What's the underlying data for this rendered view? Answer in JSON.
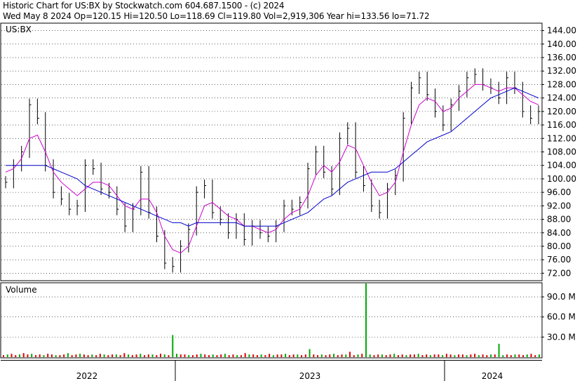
{
  "header": {
    "line1": "Historic Chart for US:BX by Stockwatch.com 604.687.1500 - (c) 2024",
    "line2": "Wed May  8 2024   Op=120.15   Hi=120.50   Lo=118.69   Cl=119.80   Vol=2,919,306   Year hi=133.56   lo=71.72"
  },
  "colors": {
    "price_bars": "#000000",
    "ma_short": "#cc00cc",
    "ma_long": "#0000cc",
    "volume_up": "#00aa00",
    "volume_down": "#dd0000",
    "grid": "#000000"
  },
  "chart_data": [
    {
      "type": "line",
      "subtype": "ohlc_bars_with_moving_averages",
      "title": "US:BX",
      "ylim": [
        70,
        146
      ],
      "y_ticks": [
        "144.00",
        "140.00",
        "136.00",
        "132.00",
        "128.00",
        "124.00",
        "120.00",
        "116.00",
        "112.00",
        "108.00",
        "104.00",
        "100.00",
        "96.00",
        "92.00",
        "88.00",
        "84.00",
        "80.00",
        "76.00",
        "72.00"
      ],
      "x_ticks": [
        "2022",
        "2023",
        "2024"
      ],
      "series": [
        {
          "name": "",
          "values": [
            99,
            104,
            108,
            122,
            118,
            104,
            96,
            94,
            91,
            92,
            104,
            103,
            97,
            96,
            91,
            86,
            91,
            102,
            90,
            83,
            75,
            74,
            80,
            85,
            96,
            98,
            90,
            88,
            84,
            88,
            82,
            86,
            84,
            83,
            86,
            92,
            91,
            93,
            103,
            108,
            102,
            97,
            112,
            115,
            102,
            98,
            92,
            90,
            97,
            101,
            118,
            127,
            130,
            125,
            120,
            116,
            122,
            126,
            130,
            131,
            128,
            127,
            124,
            130,
            127,
            120,
            118,
            120
          ]
        },
        {
          "name": "",
          "values": [
            102,
            103,
            106,
            112,
            113,
            108,
            102,
            99,
            97,
            95,
            97,
            99,
            99,
            98,
            95,
            92,
            91,
            94,
            94,
            90,
            83,
            79,
            78,
            80,
            86,
            92,
            93,
            91,
            89,
            88,
            86,
            86,
            85,
            84,
            85,
            88,
            90,
            91,
            95,
            101,
            104,
            102,
            105,
            110,
            109,
            104,
            99,
            95,
            96,
            99,
            108,
            116,
            122,
            124,
            123,
            120,
            121,
            124,
            126,
            128,
            128,
            127,
            126,
            127,
            127,
            125,
            123,
            122
          ]
        },
        {
          "name": "",
          "values": [
            104,
            104,
            104,
            104,
            104,
            104,
            103,
            102,
            101,
            100,
            98,
            97,
            96,
            95,
            94,
            93,
            92,
            91,
            90,
            89,
            88,
            87,
            87,
            86,
            87,
            87,
            87,
            87,
            87,
            87,
            86,
            86,
            86,
            86,
            86,
            87,
            88,
            89,
            90,
            92,
            94,
            95,
            97,
            99,
            100,
            101,
            102,
            102,
            102,
            103,
            105,
            107,
            109,
            111,
            112,
            113,
            114,
            116,
            118,
            120,
            122,
            124,
            125,
            126,
            127,
            126,
            125,
            124
          ]
        }
      ]
    },
    {
      "type": "bar",
      "title": "Volume",
      "ylim": [
        0,
        110
      ],
      "y_ticks": [
        "90.0 M",
        "60.0 M",
        "30.0 M"
      ],
      "values": [
        3,
        4,
        5,
        3,
        4,
        6,
        4,
        5,
        3,
        4,
        3,
        5,
        4,
        3,
        3,
        4,
        6,
        3,
        4,
        5,
        4,
        3,
        4,
        3,
        5,
        4,
        3,
        4,
        4,
        3,
        6,
        4,
        3,
        4,
        5,
        3,
        4,
        4,
        3,
        5,
        4,
        3,
        33,
        5,
        4,
        4,
        3,
        3,
        4,
        5,
        4,
        3,
        4,
        3,
        4,
        5,
        3,
        4,
        3,
        3,
        6,
        4,
        4,
        3,
        4,
        3,
        5,
        3,
        4,
        4,
        5,
        3,
        4,
        4,
        3,
        4,
        12,
        4,
        3,
        4,
        3,
        4,
        5,
        3,
        4,
        4,
        8,
        3,
        4,
        5,
        110,
        4,
        3,
        4,
        4,
        3,
        4,
        5,
        3,
        4,
        3,
        4,
        4,
        5,
        3,
        4,
        3,
        4,
        4,
        3,
        5,
        4,
        3,
        4,
        4,
        3,
        4,
        5,
        3,
        4,
        3,
        4,
        4,
        20,
        3,
        4,
        3,
        4,
        4,
        3,
        4,
        5,
        3,
        4
      ]
    }
  ]
}
